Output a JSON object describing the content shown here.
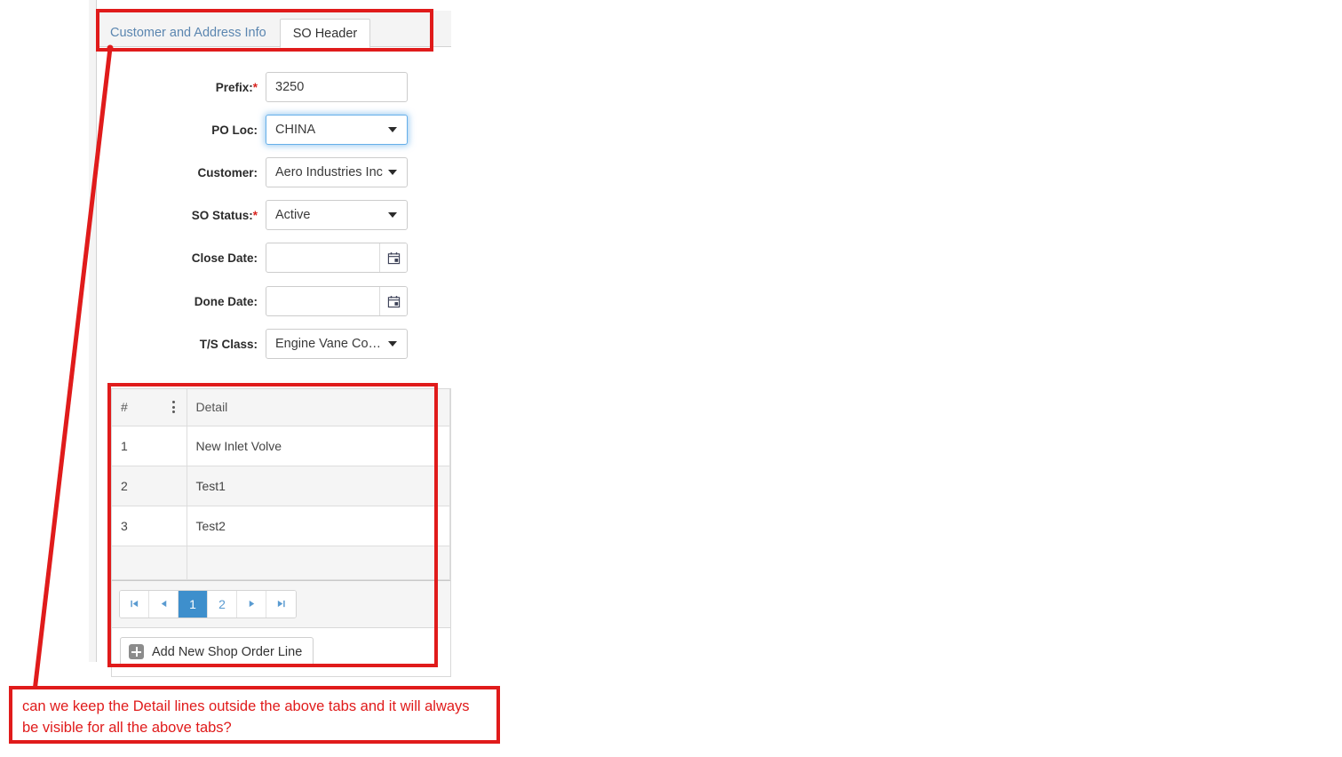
{
  "tabs": [
    {
      "label": "Customer and Address Info",
      "active": false
    },
    {
      "label": "SO Header",
      "active": true
    }
  ],
  "form": {
    "fields": [
      {
        "label": "Prefix:",
        "required": true,
        "type": "text",
        "value": "3250",
        "placeholder": ""
      },
      {
        "label": "PO Loc:",
        "required": false,
        "type": "select",
        "value": "CHINA",
        "focused": true
      },
      {
        "label": "Customer:",
        "required": false,
        "type": "select",
        "value": "Aero Industries Inc"
      },
      {
        "label": "SO Status:",
        "required": true,
        "type": "select",
        "value": "Active"
      },
      {
        "label": "Close Date:",
        "required": false,
        "type": "date",
        "value": "",
        "placeholder": ""
      },
      {
        "label": "Done Date:",
        "required": false,
        "type": "date",
        "value": "",
        "placeholder": ""
      },
      {
        "label": "T/S Class:",
        "required": false,
        "type": "select",
        "value": "Engine Vane Co…"
      }
    ]
  },
  "grid": {
    "columns": [
      "#",
      "Detail"
    ],
    "menu_icon": "kebab-menu-icon",
    "rows": [
      {
        "num": "1",
        "detail": "New Inlet Volve"
      },
      {
        "num": "2",
        "detail": "Test1"
      },
      {
        "num": "3",
        "detail": "Test2"
      }
    ],
    "blank_row": {
      "num": "",
      "detail": ""
    },
    "pager": {
      "first_icon": "first-page-icon",
      "prev_icon": "previous-page-icon",
      "pages": [
        "1",
        "2"
      ],
      "current": "1",
      "next_icon": "next-page-icon",
      "last_icon": "last-page-icon"
    },
    "add_button": {
      "label": "Add New Shop Order Line",
      "icon": "plus-icon"
    }
  },
  "annotation": {
    "text": "can we keep the Detail lines outside the above tabs and it will always be visible for all the above tabs?",
    "color": "#e01b1b"
  },
  "colors": {
    "accent_blue": "#3e8fcc",
    "tab_link": "#5b86b0",
    "required_red": "#d9241f",
    "annotation_red": "#e01b1b",
    "focus_blue": "#66afe9"
  }
}
